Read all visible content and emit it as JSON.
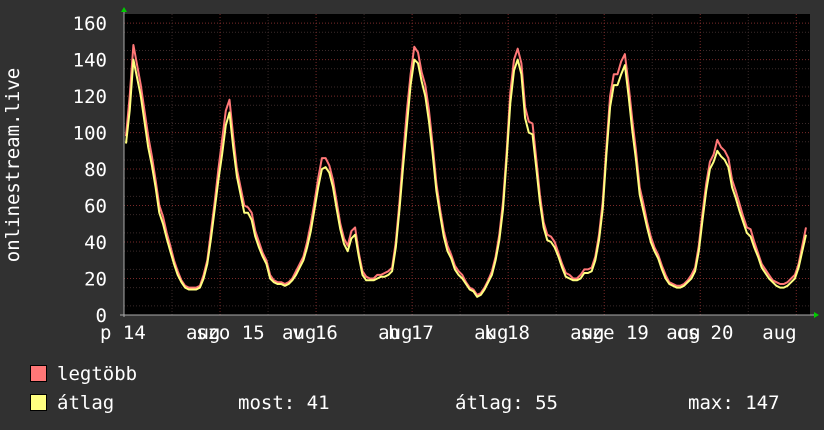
{
  "chart_data": {
    "type": "line",
    "ylabel": "onlinestream.live",
    "ylim": [
      0,
      165
    ],
    "y_ticks": [
      "0",
      "20",
      "40",
      "60",
      "80",
      "100",
      "120",
      "140",
      "160"
    ],
    "x_ticks": [
      "p 14",
      "aug",
      "szo 15",
      "aug",
      "v 16",
      "aug",
      "h 17",
      "aug",
      "k 18",
      "aug",
      "sze 19",
      "aug",
      "cs 20",
      "aug"
    ],
    "grid": true,
    "series": [
      {
        "name": "legtöbb",
        "color": "#ff7777",
        "values": [
          98,
          120,
          148,
          137,
          126,
          112,
          98,
          87,
          74,
          60,
          54,
          45,
          38,
          30,
          24,
          19,
          16,
          15,
          15,
          15,
          16,
          22,
          30,
          46,
          62,
          80,
          96,
          112,
          118,
          98,
          80,
          70,
          60,
          59,
          56,
          46,
          40,
          34,
          30,
          22,
          19,
          18,
          18,
          17,
          18,
          20,
          24,
          28,
          32,
          40,
          50,
          62,
          75,
          86,
          86,
          82,
          74,
          62,
          50,
          42,
          38,
          46,
          48,
          34,
          24,
          21,
          20,
          20,
          22,
          22,
          23,
          24,
          26,
          40,
          62,
          88,
          112,
          132,
          147,
          144,
          133,
          126,
          112,
          93,
          72,
          58,
          46,
          38,
          33,
          27,
          24,
          22,
          18,
          15,
          14,
          11,
          12,
          15,
          19,
          24,
          32,
          44,
          62,
          90,
          122,
          140,
          146,
          138,
          114,
          106,
          105,
          86,
          66,
          51,
          44,
          43,
          40,
          34,
          28,
          23,
          22,
          20,
          20,
          22,
          25,
          25,
          26,
          32,
          44,
          62,
          92,
          120,
          132,
          132,
          139,
          143,
          126,
          107,
          90,
          70,
          61,
          51,
          43,
          37,
          33,
          27,
          22,
          18,
          17,
          16,
          16,
          17,
          19,
          22,
          26,
          38,
          56,
          72,
          84,
          88,
          96,
          92,
          90,
          86,
          74,
          68,
          61,
          54,
          48,
          47,
          40,
          34,
          28,
          25,
          22,
          19,
          18,
          17,
          17,
          18,
          20,
          22,
          28,
          38,
          48
        ]
      },
      {
        "name": "átlag",
        "color": "#ffff80",
        "values": [
          94,
          112,
          140,
          130,
          120,
          106,
          92,
          82,
          70,
          56,
          50,
          42,
          35,
          28,
          22,
          18,
          15,
          14,
          14,
          14,
          15,
          20,
          28,
          42,
          58,
          74,
          88,
          104,
          111,
          92,
          76,
          66,
          56,
          56,
          52,
          43,
          37,
          32,
          28,
          20,
          18,
          17,
          17,
          16,
          17,
          19,
          22,
          26,
          30,
          37,
          46,
          58,
          70,
          80,
          81,
          78,
          70,
          58,
          47,
          39,
          35,
          42,
          44,
          32,
          22,
          19,
          19,
          19,
          20,
          21,
          21,
          22,
          24,
          37,
          58,
          82,
          104,
          126,
          140,
          138,
          128,
          120,
          106,
          88,
          68,
          55,
          43,
          35,
          31,
          25,
          22,
          20,
          17,
          14,
          13,
          10,
          11,
          14,
          18,
          22,
          30,
          41,
          58,
          86,
          116,
          134,
          140,
          132,
          108,
          100,
          99,
          81,
          62,
          48,
          41,
          40,
          37,
          32,
          26,
          21,
          20,
          19,
          19,
          20,
          23,
          23,
          24,
          30,
          41,
          58,
          88,
          114,
          126,
          126,
          132,
          137,
          120,
          101,
          85,
          66,
          57,
          48,
          40,
          35,
          31,
          25,
          20,
          17,
          16,
          15,
          15,
          16,
          18,
          20,
          24,
          35,
          52,
          68,
          80,
          84,
          90,
          87,
          85,
          81,
          70,
          64,
          57,
          51,
          45,
          43,
          37,
          32,
          26,
          23,
          20,
          18,
          16,
          15,
          15,
          16,
          18,
          20,
          26,
          35,
          44
        ]
      }
    ]
  },
  "legend": [
    {
      "label": "legtöbb",
      "color": "#ff7777"
    },
    {
      "label": "átlag",
      "color": "#ffff80"
    }
  ],
  "stats": {
    "current_label": "most:",
    "current_value": "41",
    "average_label": "átlag:",
    "average_value": "55",
    "max_label": "max:",
    "max_value": "147"
  }
}
